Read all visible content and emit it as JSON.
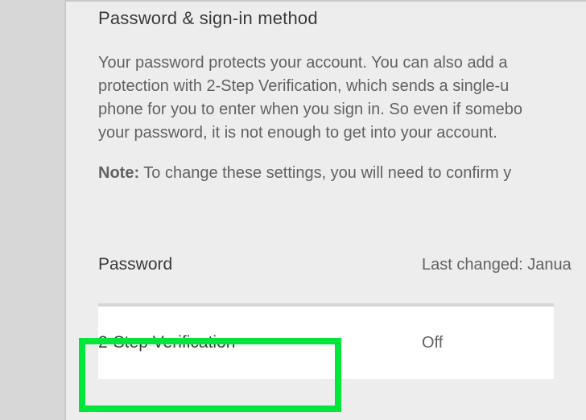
{
  "section": {
    "title": "Password & sign-in method",
    "description_l1": "Your password protects your account. You can also add a",
    "description_l2": "protection with 2-Step Verification, which sends a single-u",
    "description_l3": "phone for you to enter when you sign in. So even if somebo",
    "description_l4": "your password, it is not enough to get into your account.",
    "note_label": "Note:",
    "note_text": " To change these settings, you will need to confirm y"
  },
  "rows": {
    "password": {
      "label": "Password",
      "value": "Last changed: Janua"
    },
    "twostep": {
      "label": "2-Step Verification",
      "value": "Off"
    }
  }
}
